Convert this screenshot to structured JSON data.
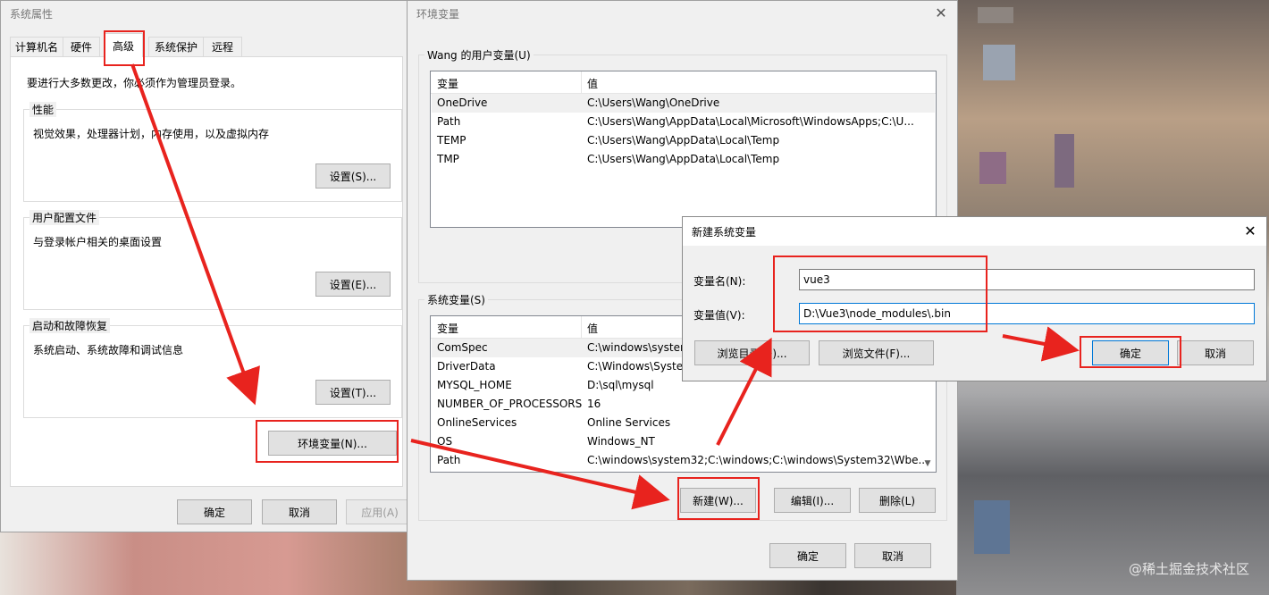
{
  "system_properties": {
    "title": "系统属性",
    "tabs": [
      "计算机名",
      "硬件",
      "高级",
      "系统保护",
      "远程"
    ],
    "notice": "要进行大多数更改，你必须作为管理员登录。",
    "performance": {
      "label": "性能",
      "desc": "视觉效果，处理器计划，内存使用，以及虚拟内存",
      "button": "设置(S)..."
    },
    "user_profile": {
      "label": "用户配置文件",
      "desc": "与登录帐户相关的桌面设置",
      "button": "设置(E)..."
    },
    "startup": {
      "label": "启动和故障恢复",
      "desc": "系统启动、系统故障和调试信息",
      "button": "设置(T)..."
    },
    "env_button": "环境变量(N)...",
    "ok": "确定",
    "cancel": "取消",
    "apply": "应用(A)"
  },
  "env_vars": {
    "title": "环境变量",
    "user_group_label": "Wang 的用户变量(U)",
    "col_var": "变量",
    "col_val": "值",
    "user_vars": [
      {
        "name": "OneDrive",
        "value": "C:\\Users\\Wang\\OneDrive"
      },
      {
        "name": "Path",
        "value": "C:\\Users\\Wang\\AppData\\Local\\Microsoft\\WindowsApps;C:\\U..."
      },
      {
        "name": "TEMP",
        "value": "C:\\Users\\Wang\\AppData\\Local\\Temp"
      },
      {
        "name": "TMP",
        "value": "C:\\Users\\Wang\\AppData\\Local\\Temp"
      }
    ],
    "system_group_label": "系统变量(S)",
    "system_vars": [
      {
        "name": "ComSpec",
        "value": "C:\\windows\\system"
      },
      {
        "name": "DriverData",
        "value": "C:\\Windows\\Syster"
      },
      {
        "name": "MYSQL_HOME",
        "value": "D:\\sql\\mysql"
      },
      {
        "name": "NUMBER_OF_PROCESSORS",
        "value": "16"
      },
      {
        "name": "OnlineServices",
        "value": "Online Services"
      },
      {
        "name": "OS",
        "value": "Windows_NT"
      },
      {
        "name": "Path",
        "value": "C:\\windows\\system32;C:\\windows;C:\\windows\\System32\\Wbe..."
      }
    ],
    "new_button": "新建(W)...",
    "edit_button": "编辑(I)...",
    "delete_button": "删除(L)",
    "ok": "确定",
    "cancel": "取消"
  },
  "new_var_dialog": {
    "title": "新建系统变量",
    "name_label": "变量名(N):",
    "name_value": "vue3",
    "value_label": "变量值(V):",
    "value_value": "D:\\Vue3\\node_modules\\.bin",
    "browse_dir": "浏览目录(D)...",
    "browse_file": "浏览文件(F)...",
    "ok": "确定",
    "cancel": "取消"
  },
  "watermark": "@稀土掘金技术社区",
  "colors": {
    "annotation": "#e8231e",
    "focus": "#0078d7",
    "dialog_bg": "#f0f0f0"
  }
}
